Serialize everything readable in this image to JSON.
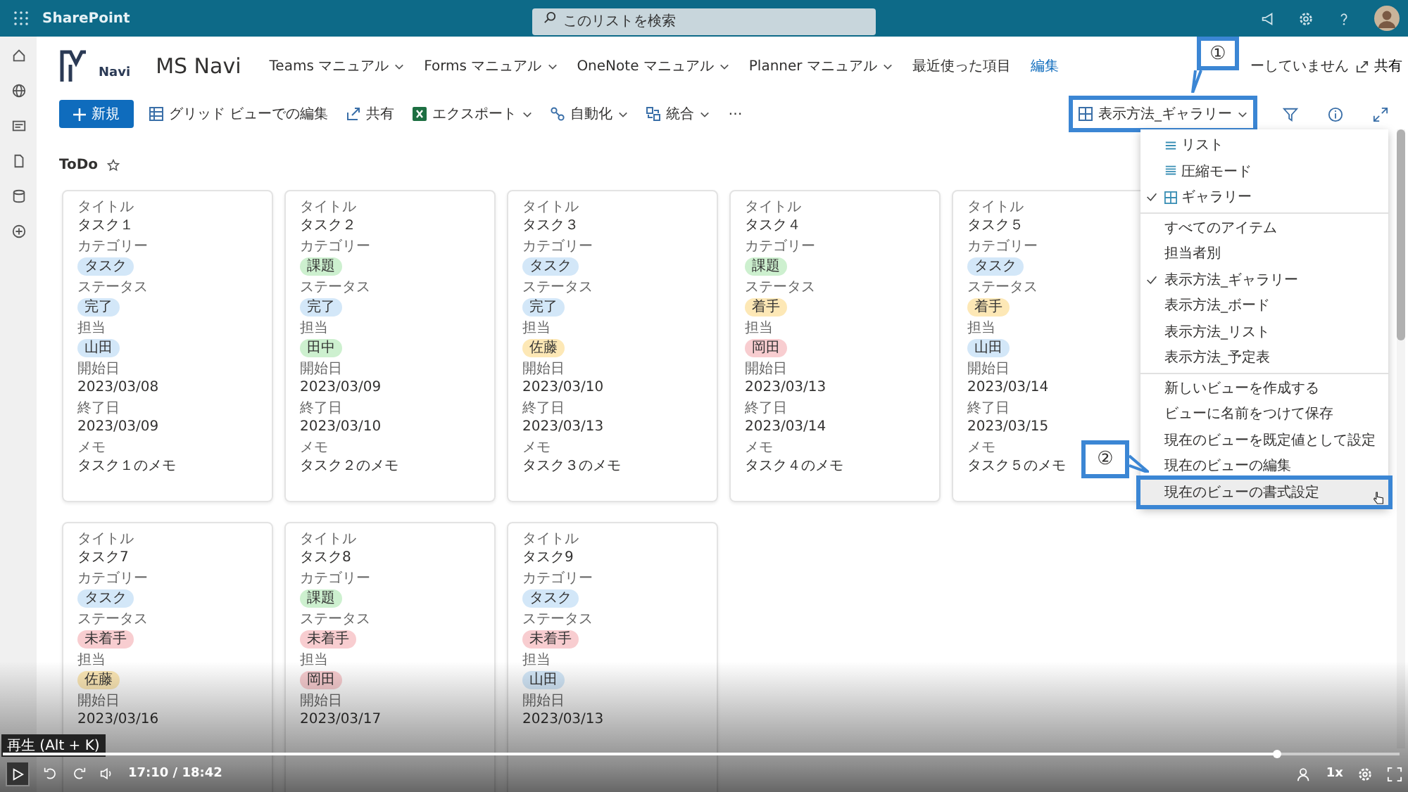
{
  "top_bar": {
    "app_name": "SharePoint",
    "search": {
      "placeholder": "このリストを検索"
    }
  },
  "site": {
    "name": "MS Navi",
    "logo_text": "Navi",
    "nav": [
      {
        "label": "Teams マニュアル",
        "kind": "menu"
      },
      {
        "label": "Forms マニュアル",
        "kind": "menu"
      },
      {
        "label": "OneNote マニュアル",
        "kind": "menu"
      },
      {
        "label": "Planner マニュアル",
        "kind": "menu"
      },
      {
        "label": "最近使った項目",
        "kind": "plain"
      },
      {
        "label": "編集",
        "kind": "link"
      }
    ],
    "follow_text": "ーしていません",
    "share": "共有"
  },
  "commands": [
    {
      "label": "新規",
      "kind": "primary"
    },
    {
      "label": "グリッド ビューでの編集",
      "kind": "grid"
    },
    {
      "label": "共有",
      "kind": "share"
    },
    {
      "label": "エクスポート",
      "kind": "excel"
    },
    {
      "label": "自動化",
      "kind": "flow"
    },
    {
      "label": "統合",
      "kind": "integrate"
    },
    {
      "label": "⋯",
      "kind": "more"
    }
  ],
  "view_button": {
    "label": "表示方法_ギャラリー",
    "highlighted": true
  },
  "list_title": "ToDo",
  "cards": [
    {
      "kind": "card",
      "fields": [
        {
          "label": "タイトル",
          "value": "タスク１",
          "kind": "title"
        },
        {
          "label": "カテゴリー",
          "value": "タスク",
          "kind": "tag",
          "color": "#d3e7f8"
        },
        {
          "label": "ステータス",
          "value": "完了",
          "kind": "tag",
          "color": "#d3e7f8"
        },
        {
          "label": "担当",
          "value": "山田",
          "kind": "tag",
          "color": "#d3e7f8"
        },
        {
          "label": "開始日",
          "value": "2023/03/08",
          "kind": "text"
        },
        {
          "label": "終了日",
          "value": "2023/03/09",
          "kind": "text"
        },
        {
          "label": "メモ",
          "value": "タスク１のメモ",
          "kind": "title"
        }
      ]
    },
    {
      "kind": "card",
      "fields": [
        {
          "label": "タイトル",
          "value": "タスク２",
          "kind": "title"
        },
        {
          "label": "カテゴリー",
          "value": "課題",
          "kind": "tag",
          "color": "#cdf0cf"
        },
        {
          "label": "ステータス",
          "value": "完了",
          "kind": "tag",
          "color": "#d3e7f8"
        },
        {
          "label": "担当",
          "value": "田中",
          "kind": "tag",
          "color": "#cdf0cf"
        },
        {
          "label": "開始日",
          "value": "2023/03/09",
          "kind": "text"
        },
        {
          "label": "終了日",
          "value": "2023/03/10",
          "kind": "text"
        },
        {
          "label": "メモ",
          "value": "タスク２のメモ",
          "kind": "title"
        }
      ]
    },
    {
      "kind": "card",
      "fields": [
        {
          "label": "タイトル",
          "value": "タスク３",
          "kind": "title"
        },
        {
          "label": "カテゴリー",
          "value": "タスク",
          "kind": "tag",
          "color": "#d3e7f8"
        },
        {
          "label": "ステータス",
          "value": "完了",
          "kind": "tag",
          "color": "#d3e7f8"
        },
        {
          "label": "担当",
          "value": "佐藤",
          "kind": "tag",
          "color": "#fde8b6"
        },
        {
          "label": "開始日",
          "value": "2023/03/10",
          "kind": "text"
        },
        {
          "label": "終了日",
          "value": "2023/03/13",
          "kind": "text"
        },
        {
          "label": "メモ",
          "value": "タスク３のメモ",
          "kind": "title"
        }
      ]
    },
    {
      "kind": "card",
      "fields": [
        {
          "label": "タイトル",
          "value": "タスク４",
          "kind": "title"
        },
        {
          "label": "カテゴリー",
          "value": "課題",
          "kind": "tag",
          "color": "#cdf0cf"
        },
        {
          "label": "ステータス",
          "value": "着手",
          "kind": "tag",
          "color": "#fde8b6"
        },
        {
          "label": "担当",
          "value": "岡田",
          "kind": "tag",
          "color": "#f8cdd0"
        },
        {
          "label": "開始日",
          "value": "2023/03/13",
          "kind": "text"
        },
        {
          "label": "終了日",
          "value": "2023/03/14",
          "kind": "text"
        },
        {
          "label": "メモ",
          "value": "タスク４のメモ",
          "kind": "title"
        }
      ]
    },
    {
      "kind": "card",
      "fields": [
        {
          "label": "タイトル",
          "value": "タスク５",
          "kind": "title"
        },
        {
          "label": "カテゴリー",
          "value": "タスク",
          "kind": "tag",
          "color": "#d3e7f8"
        },
        {
          "label": "ステータス",
          "value": "着手",
          "kind": "tag",
          "color": "#fde8b6"
        },
        {
          "label": "担当",
          "value": "山田",
          "kind": "tag",
          "color": "#d3e7f8"
        },
        {
          "label": "開始日",
          "value": "2023/03/14",
          "kind": "text"
        },
        {
          "label": "終了日",
          "value": "2023/03/15",
          "kind": "text"
        },
        {
          "label": "メモ",
          "value": "タスク５のメモ",
          "kind": "title"
        }
      ]
    },
    {
      "kind": "card",
      "fields": [
        {
          "label": "タイトル",
          "value": "タスク7",
          "kind": "title"
        },
        {
          "label": "カテゴリー",
          "value": "タスク",
          "kind": "tag",
          "color": "#d3e7f8"
        },
        {
          "label": "ステータス",
          "value": "未着手",
          "kind": "tag",
          "color": "#f8cdd0"
        },
        {
          "label": "担当",
          "value": "佐藤",
          "kind": "tag",
          "color": "#fde8b6"
        },
        {
          "label": "開始日",
          "value": "2023/03/16",
          "kind": "text"
        }
      ]
    },
    {
      "kind": "card",
      "fields": [
        {
          "label": "タイトル",
          "value": "タスク8",
          "kind": "title"
        },
        {
          "label": "カテゴリー",
          "value": "課題",
          "kind": "tag",
          "color": "#cdf0cf"
        },
        {
          "label": "ステータス",
          "value": "未着手",
          "kind": "tag",
          "color": "#f8cdd0"
        },
        {
          "label": "担当",
          "value": "岡田",
          "kind": "tag",
          "color": "#f8cdd0"
        },
        {
          "label": "開始日",
          "value": "2023/03/17",
          "kind": "text"
        }
      ]
    },
    {
      "kind": "card",
      "fields": [
        {
          "label": "タイトル",
          "value": "タスク9",
          "kind": "title"
        },
        {
          "label": "カテゴリー",
          "value": "タスク",
          "kind": "tag",
          "color": "#d3e7f8"
        },
        {
          "label": "ステータス",
          "value": "未着手",
          "kind": "tag",
          "color": "#f8cdd0"
        },
        {
          "label": "担当",
          "value": "山田",
          "kind": "tag",
          "color": "#d3e7f8"
        },
        {
          "label": "開始日",
          "value": "2023/03/13",
          "kind": "text"
        }
      ]
    }
  ],
  "view_menu": {
    "groups": [
      [
        {
          "label": "リスト",
          "kind": "list",
          "checked": false,
          "hovered": false
        },
        {
          "label": "圧縮モード",
          "kind": "compact",
          "checked": false,
          "hovered": false
        },
        {
          "label": "ギャラリー",
          "kind": "gallery",
          "checked": true,
          "hovered": false
        }
      ],
      [
        {
          "label": "すべてのアイテム",
          "checked": false,
          "hovered": false
        },
        {
          "label": "担当者別",
          "checked": false,
          "hovered": false
        },
        {
          "label": "表示方法_ギャラリー",
          "checked": true,
          "hovered": false
        },
        {
          "label": "表示方法_ボード",
          "checked": false,
          "hovered": false
        },
        {
          "label": "表示方法_リスト",
          "checked": false,
          "hovered": false
        },
        {
          "label": "表示方法_予定表",
          "checked": false,
          "hovered": false
        }
      ],
      [
        {
          "label": "新しいビューを作成する",
          "checked": false,
          "hovered": false
        },
        {
          "label": "ビューに名前をつけて保存",
          "checked": false,
          "hovered": false
        },
        {
          "label": "現在のビューを既定値として設定",
          "checked": false,
          "hovered": false
        },
        {
          "label": "現在のビューの編集",
          "checked": false,
          "hovered": false
        },
        {
          "label": "現在のビューの書式設定",
          "checked": false,
          "hovered": true
        }
      ]
    ]
  },
  "callouts": [
    "①",
    "②"
  ],
  "player": {
    "tooltip": "再生 (Alt + K)",
    "time": "17:10 / 18:42",
    "speed": "1x",
    "level": 0.912
  }
}
